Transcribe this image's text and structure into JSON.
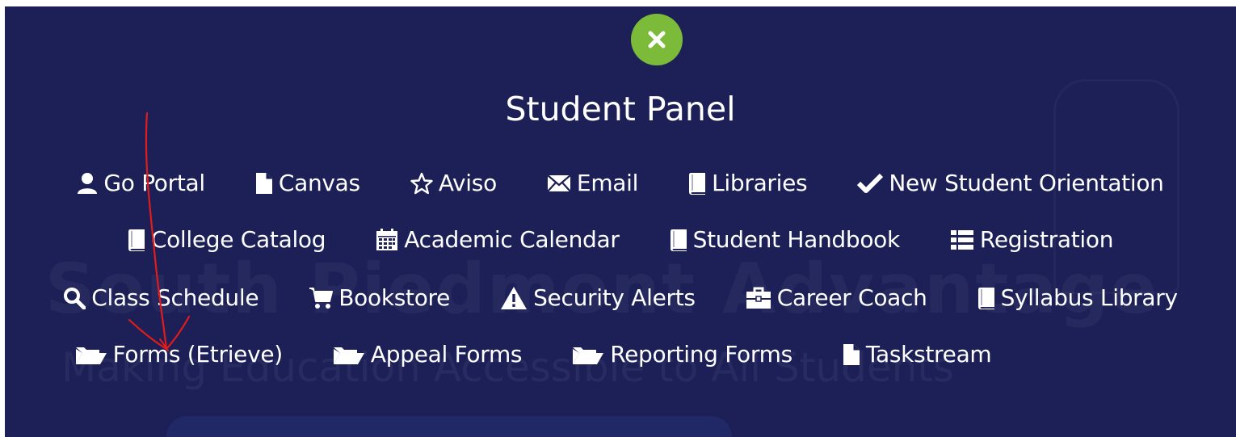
{
  "panel": {
    "title": "Student Panel",
    "close_icon": "close-x-icon",
    "accent": "#7cbb3a",
    "background": "#1c2057"
  },
  "watermark": {
    "line1": "South Piedmont Advantage",
    "line2": "Making Education Accessible to All Students"
  },
  "rows": [
    [
      {
        "label": "Go Portal",
        "icon": "user-icon"
      },
      {
        "label": "Canvas",
        "icon": "file-icon"
      },
      {
        "label": "Aviso",
        "icon": "star-outline-icon"
      },
      {
        "label": "Email",
        "icon": "envelope-icon"
      },
      {
        "label": "Libraries",
        "icon": "book-icon"
      },
      {
        "label": "New Student Orientation",
        "icon": "checkmark-icon"
      }
    ],
    [
      {
        "label": "College Catalog",
        "icon": "book-icon"
      },
      {
        "label": "Academic Calendar",
        "icon": "calendar-icon"
      },
      {
        "label": "Student Handbook",
        "icon": "book-icon"
      },
      {
        "label": "Registration",
        "icon": "list-icon"
      }
    ],
    [
      {
        "label": "Class Schedule",
        "icon": "search-icon"
      },
      {
        "label": "Bookstore",
        "icon": "cart-icon"
      },
      {
        "label": "Security Alerts",
        "icon": "warning-icon"
      },
      {
        "label": "Career Coach",
        "icon": "briefcase-icon"
      },
      {
        "label": "Syllabus Library",
        "icon": "book-icon"
      }
    ],
    [
      {
        "label": "Forms (Etrieve)",
        "icon": "folder-open-icon"
      },
      {
        "label": "Appeal Forms",
        "icon": "folder-open-icon"
      },
      {
        "label": "Reporting Forms",
        "icon": "folder-open-icon"
      },
      {
        "label": "Taskstream",
        "icon": "file-icon"
      }
    ]
  ],
  "annotation": {
    "type": "hand-drawn-arrow",
    "color": "#e02020"
  }
}
